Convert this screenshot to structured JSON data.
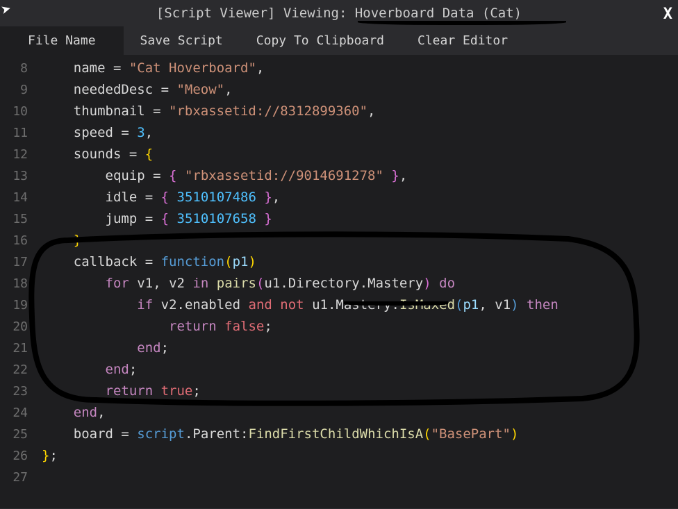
{
  "window": {
    "title": "[Script Viewer] Viewing: Hoverboard Data (Cat)",
    "close_label": "X"
  },
  "menu": {
    "file_name": "File Name",
    "save_script": "Save Script",
    "copy_clipboard": "Copy To Clipboard",
    "clear_editor": "Clear Editor"
  },
  "line_numbers": [
    "8",
    "9",
    "10",
    "11",
    "12",
    "13",
    "14",
    "15",
    "16",
    "17",
    "18",
    "19",
    "20",
    "21",
    "22",
    "23",
    "24",
    "25",
    "26",
    "27"
  ],
  "code": {
    "l8": {
      "indent": "    ",
      "key": "name",
      "eq": " = ",
      "str": "\"Cat Hoverboard\"",
      "comma": ","
    },
    "l9": {
      "indent": "    ",
      "key": "neededDesc",
      "eq": " = ",
      "str": "\"Meow\"",
      "comma": ","
    },
    "l10": {
      "indent": "    ",
      "key": "thumbnail",
      "eq": " = ",
      "str": "\"rbxassetid://8312899360\"",
      "comma": ","
    },
    "l11": {
      "indent": "    ",
      "key": "speed",
      "eq": " = ",
      "num": "3",
      "comma": ","
    },
    "l12": {
      "indent": "    ",
      "key": "sounds",
      "eq": " = ",
      "brace": "{"
    },
    "l13": {
      "indent": "        ",
      "key": "equip",
      "eq": " = ",
      "lb": "{ ",
      "str": "\"rbxassetid://9014691278\"",
      "rb": " }",
      "comma": ","
    },
    "l14": {
      "indent": "        ",
      "key": "idle",
      "eq": " = ",
      "lb": "{ ",
      "num": "3510107486",
      "rb": " }",
      "comma": ","
    },
    "l15": {
      "indent": "        ",
      "key": "jump",
      "eq": " = ",
      "lb": "{ ",
      "num": "3510107658",
      "rb": " }"
    },
    "l16": {
      "indent": "    ",
      "brace": "}"
    },
    "l17": {
      "indent": "    ",
      "key": "callback",
      "eq": " = ",
      "func": "function",
      "lp": "(",
      "p1": "p1",
      "rp": ")"
    },
    "l18": {
      "indent": "        ",
      "for": "for",
      "sp": " ",
      "v1": "v1",
      "c1": ", ",
      "v2": "v2",
      "sp2": " ",
      "in": "in",
      "sp3": " ",
      "pairs": "pairs",
      "lp": "(",
      "u1": "u1",
      "d1": ".",
      "dir": "Directory",
      "d2": ".",
      "mas": "Mastery",
      "rp": ")",
      "sp4": " ",
      "do": "do"
    },
    "l19": {
      "indent": "            ",
      "if": "if",
      "sp": " ",
      "v2": "v2",
      "d1": ".",
      "en": "enabled",
      "sp2": " ",
      "and": "and",
      "sp3": " ",
      "not": "not",
      "sp4": " ",
      "u1": "u1",
      "d2": ".",
      "mas": "Mastery",
      "d3": ".",
      "ism": "IsMaxed",
      "lp": "(",
      "p1": "p1",
      "c1": ", ",
      "v1": "v1",
      "rp": ")",
      "sp5": " ",
      "then": "then"
    },
    "l20": {
      "indent": "                ",
      "ret": "return",
      "sp": " ",
      "false": "false",
      "semi": ";"
    },
    "l21": {
      "indent": "            ",
      "end": "end",
      "semi": ";"
    },
    "l22": {
      "indent": "        ",
      "end": "end",
      "semi": ";"
    },
    "l23": {
      "indent": "        ",
      "ret": "return",
      "sp": " ",
      "true": "true",
      "semi": ";"
    },
    "l24": {
      "indent": "    ",
      "end": "end",
      "comma": ","
    },
    "l25": {
      "indent": "    ",
      "key": "board",
      "eq": " = ",
      "script": "script",
      "d1": ".",
      "parent": "Parent",
      "col": ":",
      "ffc": "FindFirstChildWhichIsA",
      "lp": "(",
      "str": "\"BasePart\"",
      "rp": ")"
    },
    "l26": {
      "indent": "",
      "brace": "}",
      "semi": ";"
    },
    "l27": {
      "indent": ""
    }
  }
}
